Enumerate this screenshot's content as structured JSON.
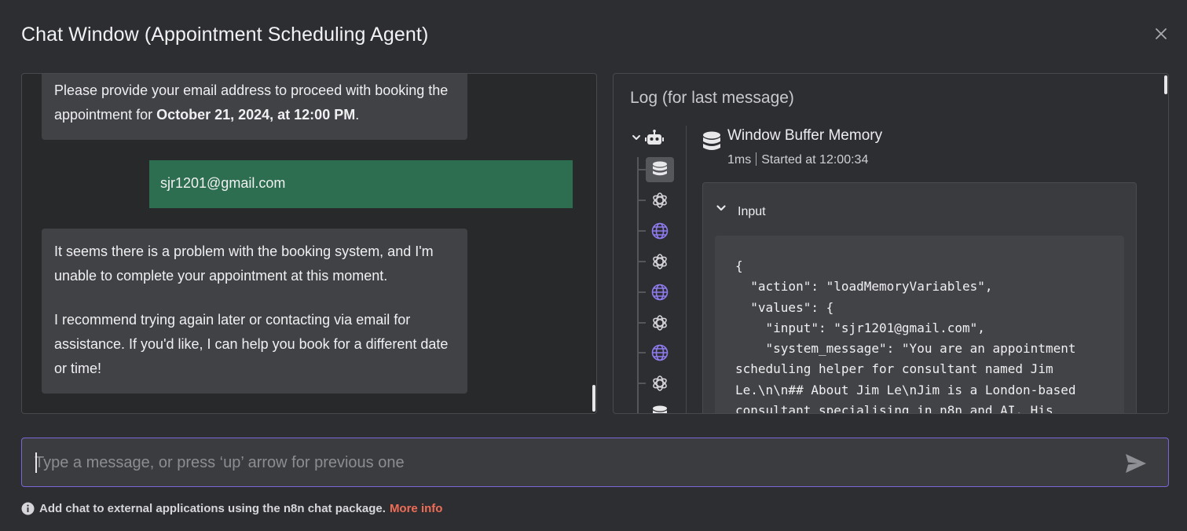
{
  "window": {
    "title": "Chat Window (Appointment Scheduling Agent)"
  },
  "chat": {
    "messages": [
      {
        "role": "bot",
        "text_before": "Please provide your email address to proceed with booking the appointment for ",
        "bold": "October 21, 2024, at 12:00 PM",
        "text_after": "."
      },
      {
        "role": "user",
        "text": "sjr1201@gmail.com"
      },
      {
        "role": "bot",
        "paragraphs": [
          "It seems there is a problem with the booking system, and I'm unable to complete your appointment at this moment.",
          "I recommend trying again later or contacting via email for assistance. If you'd like, I can help you book for a different date or time!"
        ]
      }
    ]
  },
  "log": {
    "title": "Log (for last message)",
    "tree_nodes": [
      "database-icon",
      "openai-icon",
      "globe-icon",
      "openai-icon",
      "globe-icon",
      "openai-icon",
      "globe-icon",
      "openai-icon",
      "database-icon"
    ],
    "selected": {
      "name": "Window Buffer Memory",
      "duration": "1ms",
      "started": "Started at 12:00:34",
      "input_label": "Input",
      "code": "{\n  \"action\": \"loadMemoryVariables\",\n  \"values\": {\n    \"input\": \"sjr1201@gmail.com\",\n    \"system_message\": \"You are an appointment scheduling helper for consultant named Jim Le.\\n\\n## About Jim Le\\nJim is a London-based consultant specialising in n8n and AI. His"
    }
  },
  "composer": {
    "placeholder": "Type a message, or press ‘up’ arrow for previous one"
  },
  "footer": {
    "text": "Add chat to external applications using the n8n chat package.",
    "link": "More info"
  },
  "colors": {
    "accent": "#7a66d6",
    "user_bubble": "#2c6e4f",
    "link": "#ef6d57",
    "globe": "#8f7cf0"
  }
}
